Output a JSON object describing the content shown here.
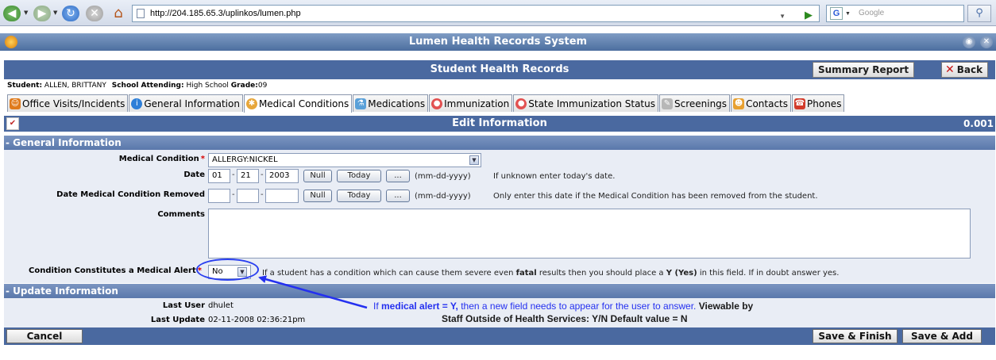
{
  "browser": {
    "url": "http://204.185.65.3/uplinkos/lumen.php",
    "search_placeholder": "Google",
    "google_logo": "G"
  },
  "app": {
    "title": "Lumen Health Records System",
    "section_title": "Student Health Records",
    "summary_report_label": "Summary Report",
    "back_label": "Back"
  },
  "student": {
    "student_label": "Student:",
    "student_value": "ALLEN, BRITTANY",
    "school_label": "School Attending:",
    "school_value": "High School",
    "grade_label": "Grade:",
    "grade_value": "09"
  },
  "tabs": [
    {
      "label": "Office Visits/Incidents",
      "icon": "office-visits-icon",
      "color": "#e07b1c"
    },
    {
      "label": "General Information",
      "icon": "info-icon",
      "color": "#2e7fd8"
    },
    {
      "label": "Medical Conditions",
      "icon": "medical-icon",
      "color": "#e7a63a"
    },
    {
      "label": "Medications",
      "icon": "medications-icon",
      "color": "#5aa0d8"
    },
    {
      "label": "Immunization",
      "icon": "immunization-icon",
      "color": "#e25151"
    },
    {
      "label": "State Immunization Status",
      "icon": "state-immunization-icon",
      "color": "#e25151"
    },
    {
      "label": "Screenings",
      "icon": "screenings-icon",
      "color": "#b7b7b7"
    },
    {
      "label": "Contacts",
      "icon": "contacts-icon",
      "color": "#e8a030"
    },
    {
      "label": "Phones",
      "icon": "phones-icon",
      "color": "#d23a2a"
    }
  ],
  "active_tab": "Medical Conditions",
  "edit": {
    "title": "Edit Information",
    "version": "0.001"
  },
  "general": {
    "title": "- General Information",
    "medical_condition_label": "Medical Condition",
    "medical_condition_value": "ALLERGY:NICKEL",
    "date_label": "Date",
    "date_month": "01",
    "date_day": "21",
    "date_year": "2003",
    "null_label": "Null",
    "today_label": "Today",
    "ellipsis_label": "...",
    "date_format": "(mm-dd-yyyy)",
    "date_hint": "If unknown enter today's date.",
    "removed_label": "Date Medical Condition Removed",
    "removed_hint": "Only enter this date if the Medical Condition has been removed from the student.",
    "comments_label": "Comments",
    "alert_label": "Condition Constitutes a Medical Alert",
    "alert_value": "No",
    "alert_hint_1": "If a student has a condition which can cause them severe even ",
    "alert_hint_fatal": "fatal",
    "alert_hint_2": " results then you should place a ",
    "alert_hint_yes": "Y (Yes)",
    "alert_hint_3": " in this field. If in doubt answer yes."
  },
  "update": {
    "title": "- Update Information",
    "last_user_label": "Last User",
    "last_user_value": "dhulet",
    "last_update_label": "Last Update",
    "last_update_value": "02-11-2008 02:36:21pm"
  },
  "annotation": {
    "line1_a": "If ",
    "line1_b": "medical alert = Y,",
    "line1_c": " then a new field needs to appear for the user to answer.",
    "line1_d": " Viewable by",
    "line2": "Staff Outside of Health Services:  Y/N  Default value = N",
    "color": "#2430f0"
  },
  "footer": {
    "cancel_label": "Cancel",
    "save_finish_label": "Save & Finish",
    "save_add_label": "Save & Add"
  },
  "colors": {
    "header_blue": "#4a69a0",
    "group_blue": "#6b86b6",
    "required_red": "#d80000"
  }
}
